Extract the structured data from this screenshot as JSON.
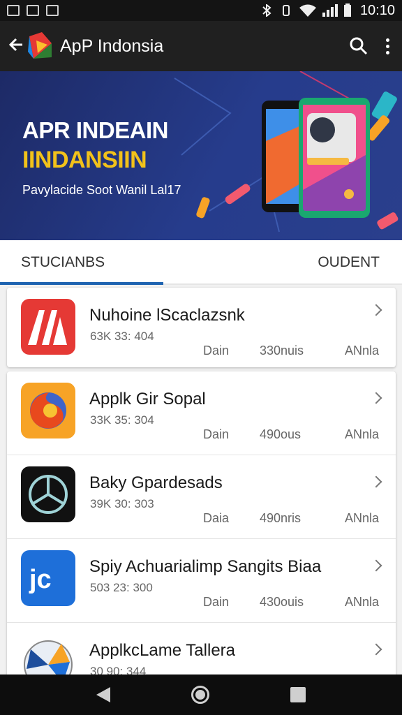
{
  "status_bar": {
    "time": "10:10"
  },
  "app_bar": {
    "title": "ApP Indonsia",
    "back_icon": "arrow-left-icon",
    "search_icon": "search-icon",
    "menu_icon": "more-vert-icon"
  },
  "banner": {
    "title_line1": "APR INDEAIN",
    "title_line2": "IINDANSIIN",
    "subtitle": "Pavylacide Soot Wanil Lal17"
  },
  "tabs": {
    "left_label": "STUCIANBS",
    "right_label": "OUDENT"
  },
  "apps": [
    {
      "name": "Nuhoine lScaclazsnk",
      "meta": "63K 33: 404",
      "col1": "Dain",
      "col2": "330nuis",
      "col3": "ANnla",
      "icon": "red-a-icon"
    },
    {
      "name": "Applk Gir Sopal",
      "meta": "33K 35: 304",
      "col1": "Dain",
      "col2": "490ous",
      "col3": "ANnla",
      "icon": "fox-globe-icon"
    },
    {
      "name": "Baky Gpardesads",
      "meta": "39K 30: 303",
      "col1": "Daia",
      "col2": "490nris",
      "col3": "ANnla",
      "icon": "star-emblem-icon"
    },
    {
      "name": "Spiy Achuarialimp Sangits Biaa",
      "meta": "503 23: 300",
      "col1": "Dain",
      "col2": "430ouis",
      "col3": "ANnla",
      "icon": "jc-letters-icon"
    },
    {
      "name": "ApplkcLame Tallera",
      "meta": "30 90: 344",
      "col1": "",
      "col2": "",
      "col3": "",
      "icon": "dial-compass-icon"
    }
  ],
  "colors": {
    "accent": "#1e63b0",
    "banner_bg": "#263c8c",
    "banner_highlight": "#f2c21a",
    "appbar_bg": "#202020"
  }
}
